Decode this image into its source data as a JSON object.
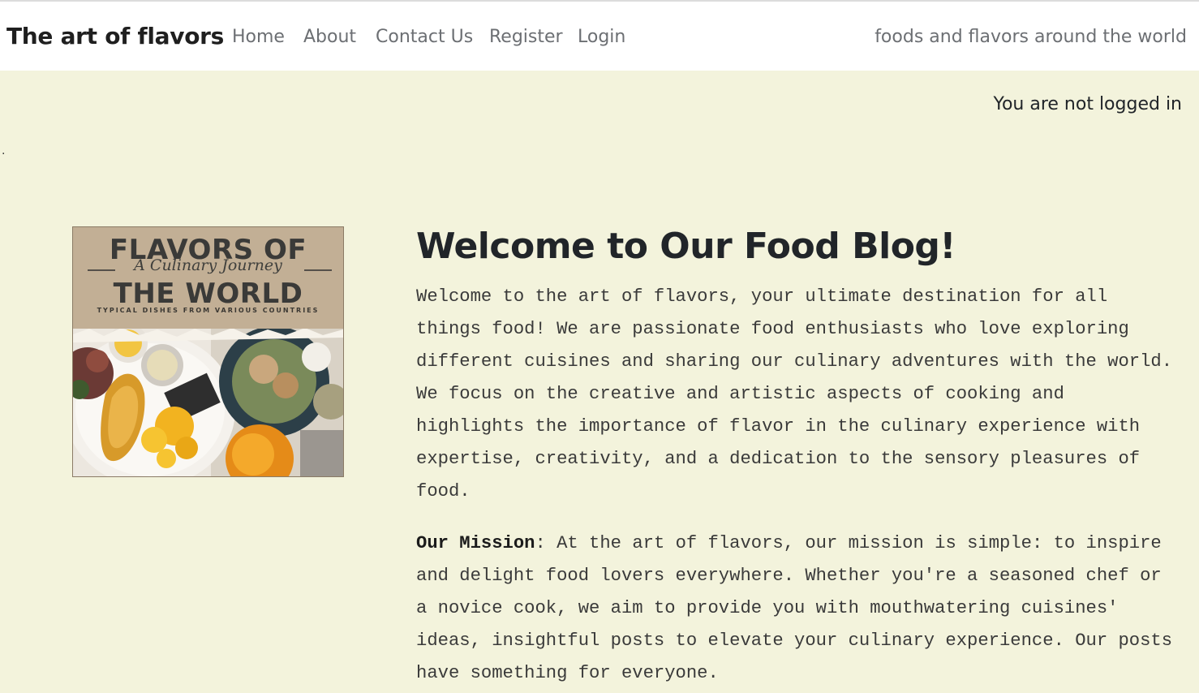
{
  "navbar": {
    "brand": "The art of flavors",
    "links": [
      "Home",
      "About",
      "Contact Us",
      "Register",
      "Login"
    ],
    "tagline": "foods and flavors around the world"
  },
  "status": "You are not logged in",
  "stray_mark": ".",
  "cover": {
    "title_line1": "FLAVORS OF",
    "script": "A Culinary Journey",
    "title_line2": "THE WORLD",
    "subtitle": "TYPICAL DISHES FROM VARIOUS COUNTRIES"
  },
  "main": {
    "heading": "Welcome to Our Food Blog!",
    "intro": "Welcome to the art of flavors, your ultimate destination for all things food! We are passionate food enthusiasts who love exploring different cuisines and sharing our culinary adventures with the world. We focus on the creative and artistic aspects of cooking and highlights the importance of flavor in the culinary experience with expertise, creativity, and a dedication to the sensory pleasures of food.",
    "mission_label": "Our Mission",
    "mission_sep": ":",
    "mission_text": " At the art of flavors, our mission is simple: to inspire and delight food lovers everywhere. Whether you're a seasoned chef or a novice cook, we aim to provide you with mouthwatering cuisines' ideas, insightful posts to elevate your culinary experience. Our posts have something for everyone."
  },
  "colors": {
    "page_bg": "#f3f3dc",
    "navbar_bg": "#ffffff",
    "nav_link": "#6c6f73",
    "text": "#212529"
  }
}
